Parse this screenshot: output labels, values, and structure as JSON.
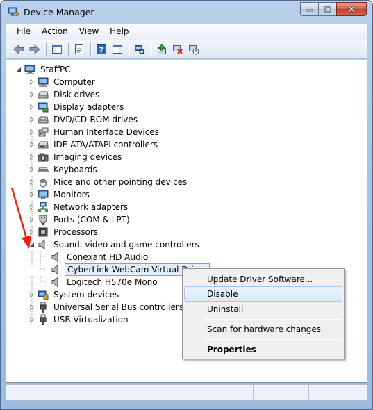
{
  "window": {
    "title": "Device Manager"
  },
  "menu": {
    "items": [
      "File",
      "Action",
      "View",
      "Help"
    ]
  },
  "toolbar": {
    "buttons": [
      "back-icon",
      "forward-icon",
      "show-hide-tree-icon",
      "properties-icon",
      "help-icon",
      "action-pane-icon",
      "scan-hardware-icon",
      "update-driver-icon",
      "uninstall-icon",
      "disable-icon"
    ]
  },
  "tree": {
    "root": "StaffPC",
    "categories": [
      "Computer",
      "Disk drives",
      "Display adapters",
      "DVD/CD-ROM drives",
      "Human Interface Devices",
      "IDE ATA/ATAPI controllers",
      "Imaging devices",
      "Keyboards",
      "Mice and other pointing devices",
      "Monitors",
      "Network adapters",
      "Ports (COM & LPT)",
      "Processors",
      "Sound, video and game controllers",
      "System devices",
      "Universal Serial Bus controllers",
      "USB Virtualization"
    ],
    "sound_children": [
      "Conexant HD Audio",
      "CyberLink WebCam Virtual Driver",
      "Logitech H570e Mono"
    ],
    "selected": "CyberLink WebCam Virtual Driver"
  },
  "context_menu": {
    "update": "Update Driver Software...",
    "disable": "Disable",
    "uninstall": "Uninstall",
    "scan": "Scan for hardware changes",
    "properties": "Properties"
  },
  "colors": {
    "selection_fill": "#e4eefb",
    "selection_border": "#7da2ce",
    "annotation_arrow": "#e8211b",
    "close_button": "#c2412a"
  }
}
